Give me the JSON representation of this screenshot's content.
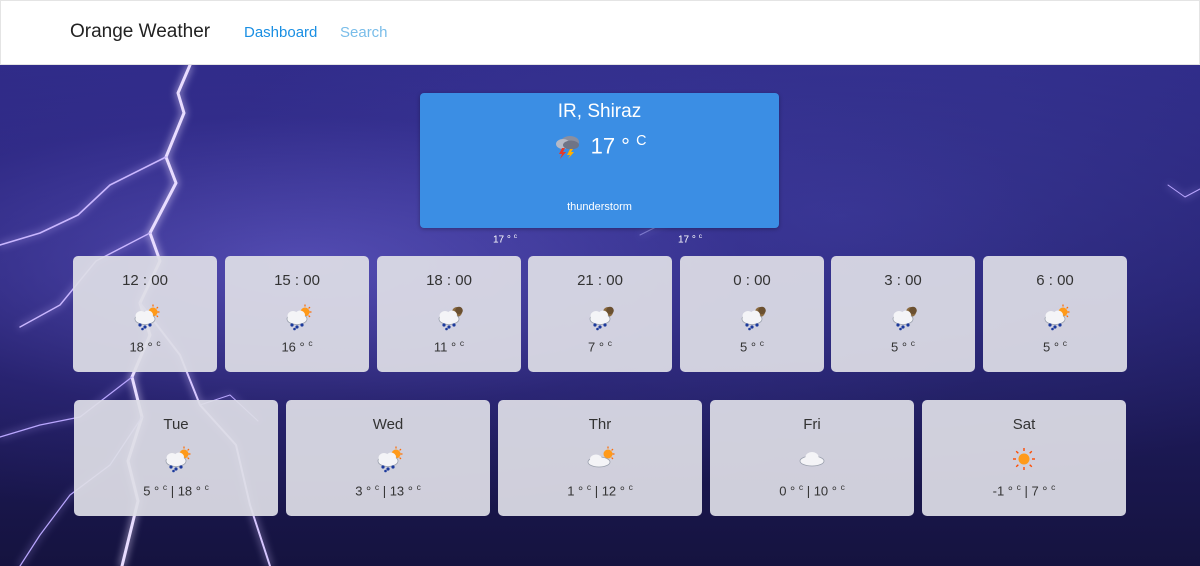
{
  "nav": {
    "brand": "Orange Weather",
    "links": [
      "Dashboard",
      "Search"
    ]
  },
  "current": {
    "city": "IR, Shiraz",
    "temp": "17 °",
    "unit": "C",
    "description": "thunderstorm",
    "min": "17 °",
    "min_unit": "c",
    "max": "17 °",
    "max_unit": "c",
    "icon": "thunderstorm-icon"
  },
  "hourly": [
    {
      "time": "12 : 00",
      "temp": "18 °",
      "unit": "c",
      "icon": "sun-rain-cloud-icon"
    },
    {
      "time": "15 : 00",
      "temp": "16 °",
      "unit": "c",
      "icon": "sun-rain-cloud-icon"
    },
    {
      "time": "18 : 00",
      "temp": "11 °",
      "unit": "c",
      "icon": "moon-rain-cloud-icon"
    },
    {
      "time": "21 : 00",
      "temp": "7 °",
      "unit": "c",
      "icon": "moon-rain-cloud-icon"
    },
    {
      "time": "0 : 00",
      "temp": "5 °",
      "unit": "c",
      "icon": "moon-rain-cloud-icon"
    },
    {
      "time": "3 : 00",
      "temp": "5 °",
      "unit": "c",
      "icon": "moon-rain-cloud-icon"
    },
    {
      "time": "6 : 00",
      "temp": "5 °",
      "unit": "c",
      "icon": "sun-rain-cloud-icon"
    }
  ],
  "daily": [
    {
      "day": "Tue",
      "min": "5 °",
      "max": "18 °",
      "unit": "c",
      "icon": "sun-rain-cloud-icon"
    },
    {
      "day": "Wed",
      "min": "3 °",
      "max": "13 °",
      "unit": "c",
      "icon": "sun-rain-cloud-icon"
    },
    {
      "day": "Thr",
      "min": "1 °",
      "max": "12 °",
      "unit": "c",
      "icon": "sun-cloud-icon"
    },
    {
      "day": "Fri",
      "min": "0 °",
      "max": "10 °",
      "unit": "c",
      "icon": "cloud-icon"
    },
    {
      "day": "Sat",
      "min": "-1 °",
      "max": "7 °",
      "unit": "c",
      "icon": "sun-icon"
    }
  ],
  "colors": {
    "accent": "#3b8ee4",
    "nav_active": "#1a8fe3",
    "nav_inactive": "#79bde9"
  }
}
